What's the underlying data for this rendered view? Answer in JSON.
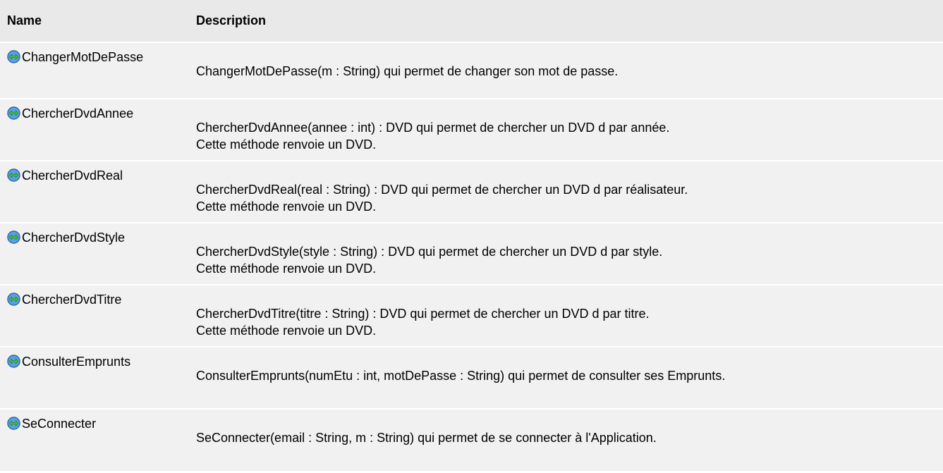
{
  "table": {
    "headers": {
      "name": "Name",
      "description": "Description"
    },
    "icon": "public-method-icon",
    "rows": [
      {
        "name": "ChangerMotDePasse",
        "description": [
          "ChangerMotDePasse(m : String) qui permet de changer son mot de passe."
        ]
      },
      {
        "name": "ChercherDvdAnnee",
        "description": [
          "ChercherDvdAnnee(annee : int) : DVD qui permet de chercher un DVD d par année.",
          "Cette méthode renvoie un DVD."
        ]
      },
      {
        "name": "ChercherDvdReal",
        "description": [
          "ChercherDvdReal(real : String) : DVD qui permet de chercher un DVD d par réalisateur.",
          "Cette méthode renvoie un DVD."
        ]
      },
      {
        "name": "ChercherDvdStyle",
        "description": [
          "ChercherDvdStyle(style : String) : DVD qui permet de chercher un DVD d par style.",
          "Cette méthode renvoie un DVD."
        ]
      },
      {
        "name": "ChercherDvdTitre",
        "description": [
          "ChercherDvdTitre(titre : String) : DVD qui permet de chercher un DVD d par titre.",
          "Cette méthode renvoie un DVD."
        ]
      },
      {
        "name": "ConsulterEmprunts",
        "description": [
          "ConsulterEmprunts(numEtu : int, motDePasse : String) qui permet de consulter ses Emprunts."
        ]
      },
      {
        "name": "SeConnecter",
        "description": [
          "SeConnecter(email : String, m : String) qui permet de se connecter à l'Application."
        ]
      }
    ]
  }
}
